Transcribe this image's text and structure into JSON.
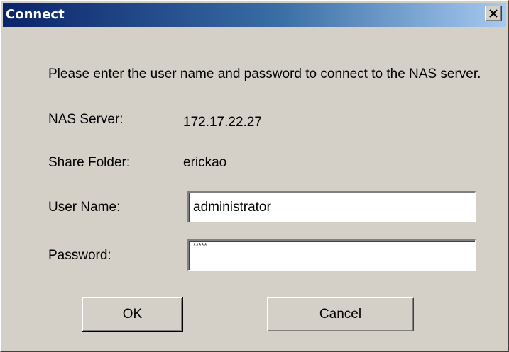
{
  "window": {
    "title": "Connect",
    "close_glyph": "✕"
  },
  "message": "Please enter the user name and password to connect to the NAS server.",
  "fields": {
    "nas_server": {
      "label": "NAS Server:",
      "value": "172.17.22.27"
    },
    "share_folder": {
      "label": "Share Folder:",
      "value": "erickao"
    },
    "user_name": {
      "label": "User Name:",
      "value": "administrator"
    },
    "password": {
      "label": "Password:",
      "value": "*****"
    }
  },
  "buttons": {
    "ok": "OK",
    "cancel": "Cancel"
  },
  "colors": {
    "title_gradient_start": "#0a246a",
    "title_gradient_end": "#a6caf0",
    "dialog_background": "#d4d0c8"
  },
  "icons": {
    "close": "close-icon"
  }
}
